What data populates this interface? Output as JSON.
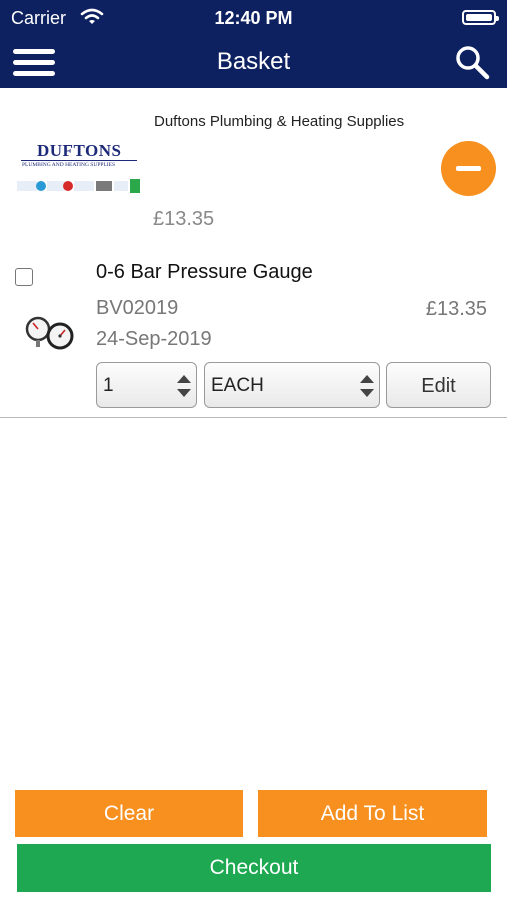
{
  "status_bar": {
    "carrier": "Carrier",
    "time": "12:40 PM"
  },
  "nav": {
    "title": "Basket",
    "menu_icon": "hamburger-icon",
    "search_icon": "search-icon"
  },
  "supplier": {
    "name": "Duftons Plumbing & Heating Supplies",
    "logo_text": "DUFTONS",
    "logo_subtext": "PLUMBING AND HEATING SUPPLIES",
    "total": "£13.35"
  },
  "items": [
    {
      "name": "0-6 Bar Pressure Gauge",
      "code": "BV02019",
      "date": "24-Sep-2019",
      "price": "£13.35",
      "quantity": "1",
      "unit": "EACH",
      "edit_label": "Edit"
    }
  ],
  "actions": {
    "clear": "Clear",
    "add_to_list": "Add To List",
    "checkout": "Checkout"
  },
  "colors": {
    "nav_bg": "#0d2161",
    "orange": "#f7901e",
    "green": "#1da851"
  }
}
